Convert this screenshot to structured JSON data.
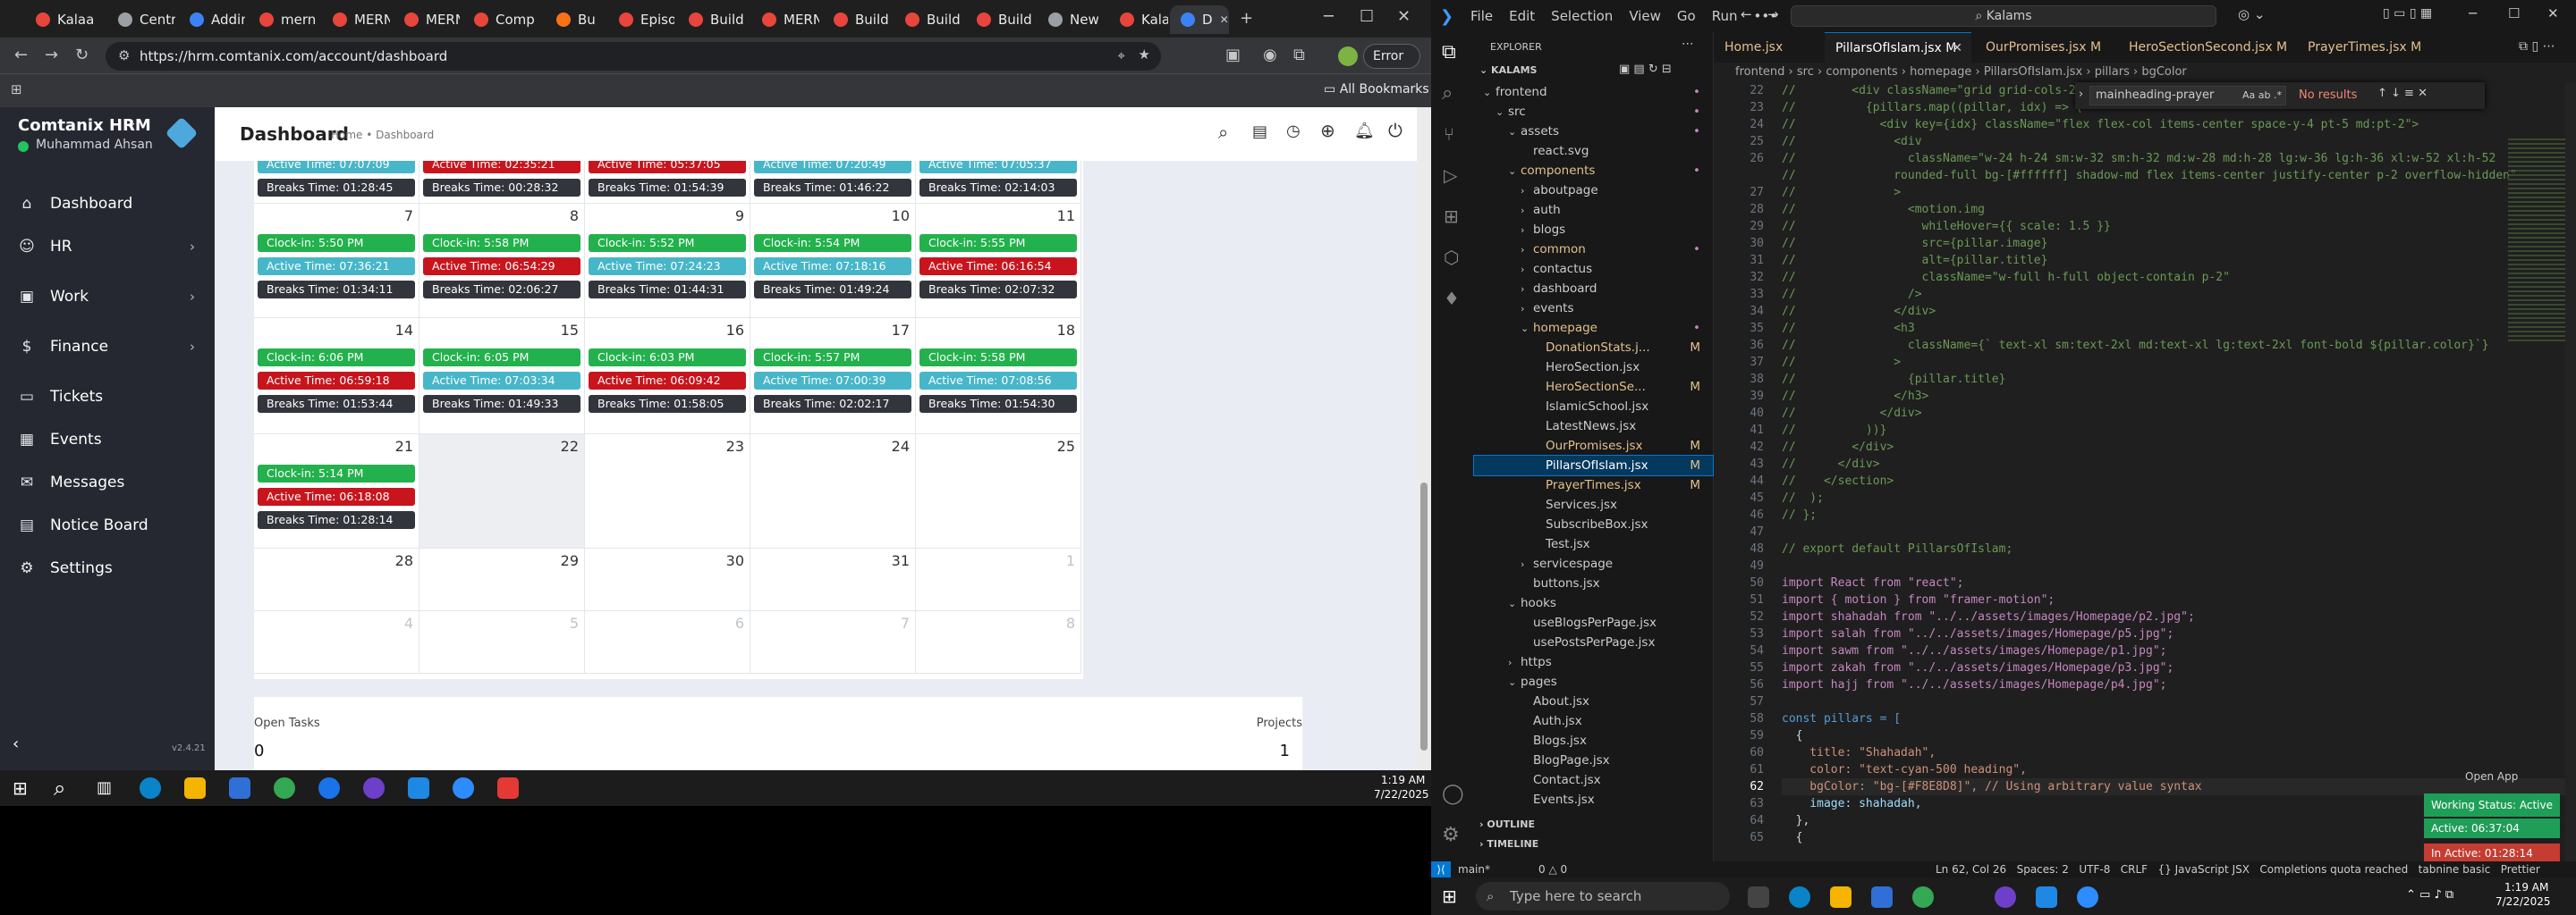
{
  "browser": {
    "tabs": [
      {
        "label": "Kalaa",
        "color": "#e8453c"
      },
      {
        "label": "Centr",
        "color": "#9aa0a6"
      },
      {
        "label": "Addin",
        "color": "#3b82f6"
      },
      {
        "label": "mern",
        "color": "#e8453c"
      },
      {
        "label": "MERN",
        "color": "#e8453c"
      },
      {
        "label": "MERN",
        "color": "#e8453c"
      },
      {
        "label": "Comp",
        "color": "#e8453c"
      },
      {
        "label": "Bu",
        "color": "#f97316"
      },
      {
        "label": "Episo",
        "color": "#e8453c"
      },
      {
        "label": "Build",
        "color": "#e8453c"
      },
      {
        "label": "MERN",
        "color": "#e8453c"
      },
      {
        "label": "Build",
        "color": "#e8453c"
      },
      {
        "label": "Build",
        "color": "#e8453c"
      },
      {
        "label": "Build",
        "color": "#e8453c"
      },
      {
        "label": "New",
        "color": "#9aa0a6"
      },
      {
        "label": "Kalaa",
        "color": "#e8453c"
      },
      {
        "label": "D",
        "color": "#3b82f6"
      }
    ],
    "url": "https://hrm.comtanix.com/account/dashboard",
    "error_label": "Error",
    "bookmarks_label": "All Bookmarks"
  },
  "hrm": {
    "brand": "Comtanix HRM",
    "user": "Muhammad Ahsan",
    "page_title": "Dashboard",
    "breadcrumb": "Home • Dashboard",
    "version": "v2.4.21",
    "nav": [
      {
        "label": "Dashboard",
        "icon": "home-icon",
        "chevron": ""
      },
      {
        "label": "HR",
        "icon": "users-icon",
        "chevron": "›"
      },
      {
        "label": "Work",
        "icon": "briefcase-icon",
        "chevron": "›"
      },
      {
        "label": "Finance",
        "icon": "dollar-icon",
        "chevron": "›"
      },
      {
        "label": "Tickets",
        "icon": "ticket-icon",
        "chevron": ""
      },
      {
        "label": "Events",
        "icon": "calendar-icon",
        "chevron": ""
      },
      {
        "label": "Messages",
        "icon": "message-icon",
        "chevron": ""
      },
      {
        "label": "Notice Board",
        "icon": "notice-icon",
        "chevron": ""
      },
      {
        "label": "Settings",
        "icon": "settings-icon",
        "chevron": ""
      }
    ],
    "calendar": {
      "top_row": [
        [
          "Active Time: 07:07:09",
          "Breaks Time: 01:28:45"
        ],
        [
          "Active Time: 02:35:21",
          "Breaks Time: 00:28:32"
        ],
        [
          "Active Time: 05:37:05",
          "Breaks Time: 01:54:39"
        ],
        [
          "Active Time: 07:20:49",
          "Breaks Time: 01:46:22"
        ],
        [
          "Active Time: 07:05:37",
          "Breaks Time: 02:14:03"
        ]
      ],
      "weeks": [
        {
          "days": [
            {
              "num": "7",
              "clock": "Clock-in: 5:50 PM",
              "active": "Active Time: 07:36:21",
              "active_color": "cyan",
              "breaks": "Breaks Time: 01:34:11"
            },
            {
              "num": "8",
              "clock": "Clock-in: 5:58 PM",
              "active": "Active Time: 06:54:29",
              "active_color": "red",
              "breaks": "Breaks Time: 02:06:27"
            },
            {
              "num": "9",
              "clock": "Clock-in: 5:52 PM",
              "active": "Active Time: 07:24:23",
              "active_color": "cyan",
              "breaks": "Breaks Time: 01:44:31"
            },
            {
              "num": "10",
              "clock": "Clock-in: 5:54 PM",
              "active": "Active Time: 07:18:16",
              "active_color": "cyan",
              "breaks": "Breaks Time: 01:49:24"
            },
            {
              "num": "11",
              "clock": "Clock-in: 5:55 PM",
              "active": "Active Time: 06:16:54",
              "active_color": "red",
              "breaks": "Breaks Time: 02:07:32"
            }
          ]
        },
        {
          "days": [
            {
              "num": "14",
              "clock": "Clock-in: 6:06 PM",
              "active": "Active Time: 06:59:18",
              "active_color": "red",
              "breaks": "Breaks Time: 01:53:44"
            },
            {
              "num": "15",
              "clock": "Clock-in: 6:05 PM",
              "active": "Active Time: 07:03:34",
              "active_color": "cyan",
              "breaks": "Breaks Time: 01:49:33"
            },
            {
              "num": "16",
              "clock": "Clock-in: 6:03 PM",
              "active": "Active Time: 06:09:42",
              "active_color": "red",
              "breaks": "Breaks Time: 01:58:05"
            },
            {
              "num": "17",
              "clock": "Clock-in: 5:57 PM",
              "active": "Active Time: 07:00:39",
              "active_color": "cyan",
              "breaks": "Breaks Time: 02:02:17"
            },
            {
              "num": "18",
              "clock": "Clock-in: 5:58 PM",
              "active": "Active Time: 07:08:56",
              "active_color": "cyan",
              "breaks": "Breaks Time: 01:54:30"
            }
          ]
        },
        {
          "days": [
            {
              "num": "21",
              "clock": "Clock-in: 5:14 PM",
              "active": "Active Time: 06:18:08",
              "active_color": "red",
              "breaks": "Breaks Time: 01:28:14"
            },
            {
              "num": "22",
              "clock": "",
              "active": "",
              "active_color": "",
              "breaks": ""
            },
            {
              "num": "23",
              "clock": "",
              "active": "",
              "active_color": "",
              "breaks": ""
            },
            {
              "num": "24",
              "clock": "",
              "active": "",
              "active_color": "",
              "breaks": ""
            },
            {
              "num": "25",
              "clock": "",
              "active": "",
              "active_color": "",
              "breaks": ""
            }
          ]
        }
      ],
      "row_28": [
        "28",
        "29",
        "30",
        "31",
        "1"
      ],
      "row_next": [
        "4",
        "5",
        "6",
        "7",
        "8"
      ]
    },
    "open_tasks_label": "Open Tasks",
    "open_tasks_value": "0",
    "projects_label": "Projects",
    "projects_value": "1"
  },
  "vscode": {
    "menu": [
      "File",
      "Edit",
      "Selection",
      "View",
      "Go",
      "Run",
      "•••"
    ],
    "search": "Kalams",
    "explorer_title": "EXPLORER",
    "root": "KALAMS",
    "tree": [
      {
        "label": "frontend",
        "indent": 0,
        "arrow": "⌄",
        "color": "#cccccc",
        "badge": "•"
      },
      {
        "label": "src",
        "indent": 1,
        "arrow": "⌄",
        "color": "#cccccc",
        "badge": "•"
      },
      {
        "label": "assets",
        "indent": 2,
        "arrow": "⌄",
        "color": "#cccccc",
        "badge": "•"
      },
      {
        "label": "react.svg",
        "indent": 3,
        "arrow": "",
        "color": "#cccccc",
        "badge": ""
      },
      {
        "label": "components",
        "indent": 2,
        "arrow": "⌄",
        "color": "#e2c08d",
        "badge": "•"
      },
      {
        "label": "aboutpage",
        "indent": 3,
        "arrow": "›",
        "color": "#cccccc",
        "badge": ""
      },
      {
        "label": "auth",
        "indent": 3,
        "arrow": "›",
        "color": "#cccccc",
        "badge": ""
      },
      {
        "label": "blogs",
        "indent": 3,
        "arrow": "›",
        "color": "#cccccc",
        "badge": ""
      },
      {
        "label": "common",
        "indent": 3,
        "arrow": "›",
        "color": "#e2c08d",
        "badge": "•"
      },
      {
        "label": "contactus",
        "indent": 3,
        "arrow": "›",
        "color": "#cccccc",
        "badge": ""
      },
      {
        "label": "dashboard",
        "indent": 3,
        "arrow": "›",
        "color": "#cccccc",
        "badge": ""
      },
      {
        "label": "events",
        "indent": 3,
        "arrow": "›",
        "color": "#cccccc",
        "badge": ""
      },
      {
        "label": "homepage",
        "indent": 3,
        "arrow": "⌄",
        "color": "#e2c08d",
        "badge": "•"
      },
      {
        "label": "DonationStats.j...",
        "indent": 4,
        "arrow": "",
        "color": "#e2c08d",
        "badge": "M"
      },
      {
        "label": "HeroSection.jsx",
        "indent": 4,
        "arrow": "",
        "color": "#cccccc",
        "badge": ""
      },
      {
        "label": "HeroSectionSe...",
        "indent": 4,
        "arrow": "",
        "color": "#e2c08d",
        "badge": "M"
      },
      {
        "label": "IslamicSchool.jsx",
        "indent": 4,
        "arrow": "",
        "color": "#cccccc",
        "badge": ""
      },
      {
        "label": "LatestNews.jsx",
        "indent": 4,
        "arrow": "",
        "color": "#cccccc",
        "badge": ""
      },
      {
        "label": "OurPromises.jsx",
        "indent": 4,
        "arrow": "",
        "color": "#e2c08d",
        "badge": "M"
      },
      {
        "label": "PillarsOfIslam.jsx",
        "indent": 4,
        "arrow": "",
        "color": "#ffffff",
        "badge": "M",
        "selected": true
      },
      {
        "label": "PrayerTimes.jsx",
        "indent": 4,
        "arrow": "",
        "color": "#e2c08d",
        "badge": "M"
      },
      {
        "label": "Services.jsx",
        "indent": 4,
        "arrow": "",
        "color": "#cccccc",
        "badge": ""
      },
      {
        "label": "SubscribeBox.jsx",
        "indent": 4,
        "arrow": "",
        "color": "#cccccc",
        "badge": ""
      },
      {
        "label": "Test.jsx",
        "indent": 4,
        "arrow": "",
        "color": "#cccccc",
        "badge": ""
      },
      {
        "label": "servicespage",
        "indent": 3,
        "arrow": "›",
        "color": "#cccccc",
        "badge": ""
      },
      {
        "label": "buttons.jsx",
        "indent": 3,
        "arrow": "",
        "color": "#cccccc",
        "badge": ""
      },
      {
        "label": "hooks",
        "indent": 2,
        "arrow": "⌄",
        "color": "#cccccc",
        "badge": ""
      },
      {
        "label": "useBlogsPerPage.jsx",
        "indent": 3,
        "arrow": "",
        "color": "#cccccc",
        "badge": ""
      },
      {
        "label": "usePostsPerPage.jsx",
        "indent": 3,
        "arrow": "",
        "color": "#cccccc",
        "badge": ""
      },
      {
        "label": "https",
        "indent": 2,
        "arrow": "›",
        "color": "#cccccc",
        "badge": ""
      },
      {
        "label": "pages",
        "indent": 2,
        "arrow": "⌄",
        "color": "#cccccc",
        "badge": ""
      },
      {
        "label": "About.jsx",
        "indent": 3,
        "arrow": "",
        "color": "#cccccc",
        "badge": ""
      },
      {
        "label": "Auth.jsx",
        "indent": 3,
        "arrow": "",
        "color": "#cccccc",
        "badge": ""
      },
      {
        "label": "Blogs.jsx",
        "indent": 3,
        "arrow": "",
        "color": "#cccccc",
        "badge": ""
      },
      {
        "label": "BlogPage.jsx",
        "indent": 3,
        "arrow": "",
        "color": "#cccccc",
        "badge": ""
      },
      {
        "label": "Contact.jsx",
        "indent": 3,
        "arrow": "",
        "color": "#cccccc",
        "badge": ""
      },
      {
        "label": "Events.jsx",
        "indent": 3,
        "arrow": "",
        "color": "#cccccc",
        "badge": ""
      }
    ],
    "outline": "OUTLINE",
    "timeline": "TIMELINE",
    "editor_tabs": [
      {
        "label": "Home.jsx",
        "active": false
      },
      {
        "label": "PillarsOfIslam.jsx M",
        "active": true
      },
      {
        "label": "OurPromises.jsx M",
        "active": false
      },
      {
        "label": "HeroSectionSecond.jsx M",
        "active": false
      },
      {
        "label": "PrayerTimes.jsx M",
        "active": false
      }
    ],
    "breadcrumb": "frontend › src › components › homepage › PillarsOfIslam.jsx › pillars › bgColor",
    "find_query": "mainheading-prayer",
    "find_result": "No results",
    "code": [
      {
        "n": "22",
        "t": "//        <div className=\"grid grid-cols-2 md:gri",
        "c": "#6a9955"
      },
      {
        "n": "23",
        "t": "//          {pillars.map((pillar, idx) => (",
        "c": "#6a9955"
      },
      {
        "n": "24",
        "t": "//            <div key={idx} className=\"flex flex-col items-center space-y-4 pt-5 md:pt-2\">",
        "c": "#6a9955"
      },
      {
        "n": "25",
        "t": "//              <div",
        "c": "#6a9955"
      },
      {
        "n": "26",
        "t": "//                className=\"w-24 h-24 sm:w-32 sm:h-32 md:w-28 md:h-28 lg:w-36 lg:h-36 xl:w-52 xl:h-52",
        "c": "#6a9955"
      },
      {
        "n": "",
        "t": "//              rounded-full bg-[#ffffff] shadow-md flex items-center justify-center p-2 overflow-hidden\"",
        "c": "#6a9955"
      },
      {
        "n": "27",
        "t": "//              >",
        "c": "#6a9955"
      },
      {
        "n": "28",
        "t": "//                <motion.img",
        "c": "#6a9955"
      },
      {
        "n": "29",
        "t": "//                  whileHover={{ scale: 1.5 }}",
        "c": "#6a9955"
      },
      {
        "n": "30",
        "t": "//                  src={pillar.image}",
        "c": "#6a9955"
      },
      {
        "n": "31",
        "t": "//                  alt={pillar.title}",
        "c": "#6a9955"
      },
      {
        "n": "32",
        "t": "//                  className=\"w-full h-full object-contain p-2\"",
        "c": "#6a9955"
      },
      {
        "n": "33",
        "t": "//                />",
        "c": "#6a9955"
      },
      {
        "n": "34",
        "t": "//              </div>",
        "c": "#6a9955"
      },
      {
        "n": "35",
        "t": "//              <h3",
        "c": "#6a9955"
      },
      {
        "n": "36",
        "t": "//                className={` text-xl sm:text-2xl md:text-xl lg:text-2xl font-bold ${pillar.color}`}",
        "c": "#6a9955"
      },
      {
        "n": "37",
        "t": "//              >",
        "c": "#6a9955"
      },
      {
        "n": "38",
        "t": "//                {pillar.title}",
        "c": "#6a9955"
      },
      {
        "n": "39",
        "t": "//              </h3>",
        "c": "#6a9955"
      },
      {
        "n": "40",
        "t": "//            </div>",
        "c": "#6a9955"
      },
      {
        "n": "41",
        "t": "//          ))}",
        "c": "#6a9955"
      },
      {
        "n": "42",
        "t": "//        </div>",
        "c": "#6a9955"
      },
      {
        "n": "43",
        "t": "//      </div>",
        "c": "#6a9955"
      },
      {
        "n": "44",
        "t": "//    </section>",
        "c": "#6a9955"
      },
      {
        "n": "45",
        "t": "//  );",
        "c": "#6a9955"
      },
      {
        "n": "46",
        "t": "// };",
        "c": "#6a9955"
      },
      {
        "n": "47",
        "t": "",
        "c": "#6a9955"
      },
      {
        "n": "48",
        "t": "// export default PillarsOfIslam;",
        "c": "#6a9955"
      },
      {
        "n": "49",
        "t": "",
        "c": "#6a9955"
      },
      {
        "n": "50",
        "t": "import React from \"react\";",
        "c": "#c586c0"
      },
      {
        "n": "51",
        "t": "import { motion } from \"framer-motion\";",
        "c": "#c586c0"
      },
      {
        "n": "52",
        "t": "import shahadah from \"../../assets/images/Homepage/p2.jpg\";",
        "c": "#c586c0"
      },
      {
        "n": "53",
        "t": "import salah from \"../../assets/images/Homepage/p5.jpg\";",
        "c": "#c586c0"
      },
      {
        "n": "54",
        "t": "import sawm from \"../../assets/images/Homepage/p1.jpg\";",
        "c": "#c586c0"
      },
      {
        "n": "55",
        "t": "import zakah from \"../../assets/images/Homepage/p3.jpg\";",
        "c": "#c586c0"
      },
      {
        "n": "56",
        "t": "import hajj from \"../../assets/images/Homepage/p4.jpg\";",
        "c": "#c586c0"
      },
      {
        "n": "57",
        "t": "",
        "c": "#6a9955"
      },
      {
        "n": "58",
        "t": "const pillars = [",
        "c": "#569cd6"
      },
      {
        "n": "59",
        "t": "  {",
        "c": "#d4d4d4"
      },
      {
        "n": "60",
        "t": "    title: \"Shahadah\",",
        "c": "#ce9178"
      },
      {
        "n": "61",
        "t": "    color: \"text-cyan-500 heading\",",
        "c": "#ce9178"
      },
      {
        "n": "62",
        "t": "    bgColor: \"bg-[#F8E8D8]\", // Using arbitrary value syntax",
        "c": "#ce9178"
      },
      {
        "n": "63",
        "t": "    image: shahadah,",
        "c": "#9cdcfe"
      },
      {
        "n": "64",
        "t": "  },",
        "c": "#d4d4d4"
      },
      {
        "n": "65",
        "t": "  {",
        "c": "#d4d4d4"
      }
    ],
    "open_app": "Open App",
    "status_left": "main*",
    "status_errors": "0 △ 0",
    "status_right": "Ln 62, Col 26   Spaces: 2   UTF-8   CRLF   {} JavaScript JSX   Completions quota reached   tabnine basic   Prettier",
    "widget": {
      "working_status": "Working Status: Active",
      "active": "Active: 06:37:04",
      "inactive": "In Active: 01:28:14"
    }
  },
  "taskbar": {
    "search_placeholder": "Type here to search",
    "time": "1:19 AM",
    "date": "7/22/2025"
  }
}
